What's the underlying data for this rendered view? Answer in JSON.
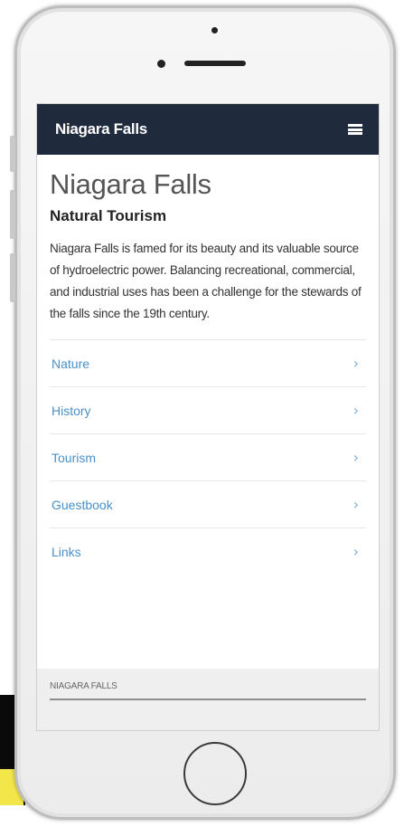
{
  "header": {
    "title": "Niagara Falls",
    "menu_icon": "hamburger-menu-icon"
  },
  "main": {
    "title": "Niagara Falls",
    "subtitle": "Natural Tourism",
    "description": "Niagara Falls is famed for its beauty and its valuable source of hydroelectric power. Balancing recreational, commercial, and industrial uses has been a challenge for the stewards of the falls since the 19th century."
  },
  "nav": {
    "items": [
      {
        "label": "Nature"
      },
      {
        "label": "History"
      },
      {
        "label": "Tourism"
      },
      {
        "label": "Guestbook"
      },
      {
        "label": "Links"
      }
    ],
    "chevron": "›"
  },
  "footer": {
    "text": "NIAGARA FALLS"
  },
  "colors": {
    "navbar": "#1f2a3d",
    "link": "#4a90c8",
    "footer_bg": "#efefef"
  }
}
